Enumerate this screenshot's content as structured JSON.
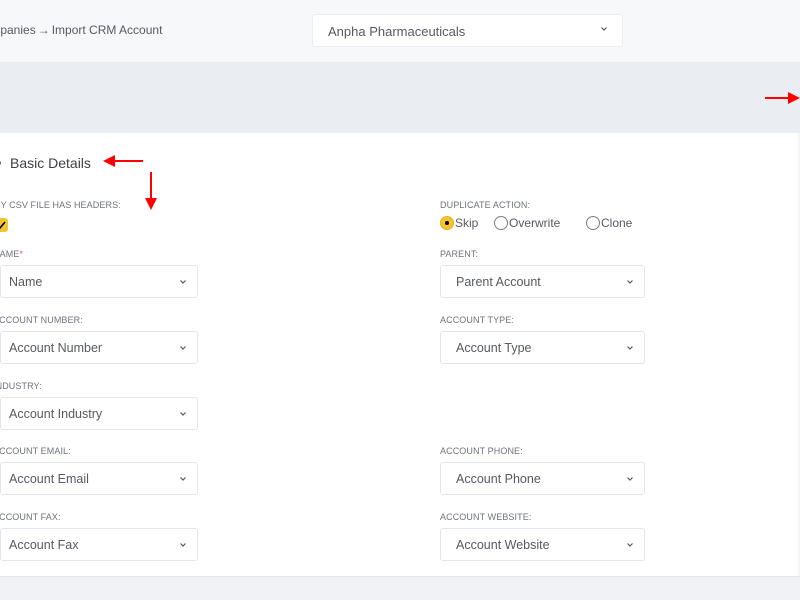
{
  "breadcrumb": {
    "parent": "Companies",
    "separator": "→",
    "current": "Import CRM Account"
  },
  "company_select": {
    "value": "Anpha Pharmaceuticals"
  },
  "section": {
    "title": "Basic Details"
  },
  "form": {
    "csv_headers": {
      "label": "My CSV File Has Headers:",
      "checked": true
    },
    "duplicate_action": {
      "label": "Duplicate Action:",
      "options": [
        "Skip",
        "Overwrite",
        "Clone"
      ],
      "selected": "Skip"
    },
    "name": {
      "label": "Name",
      "required_mark": "*",
      "value": "Name"
    },
    "parent": {
      "label": "Parent:",
      "value": "Parent Account"
    },
    "account_number": {
      "label": "Account Number:",
      "value": "Account Number"
    },
    "account_type": {
      "label": "Account Type:",
      "value": "Account Type"
    },
    "industry": {
      "label": "Industry:",
      "value": "Account Industry"
    },
    "account_email": {
      "label": "Account Email:",
      "value": "Account Email"
    },
    "account_phone": {
      "label": "Account Phone:",
      "value": "Account Phone"
    },
    "account_fax": {
      "label": "Account Fax:",
      "value": "Account Fax"
    },
    "account_website": {
      "label": "Account Website:",
      "value": "Account Website"
    }
  },
  "colors": {
    "accent": "#f4c430",
    "annotation": "#ff0000",
    "required": "#f4516c"
  }
}
